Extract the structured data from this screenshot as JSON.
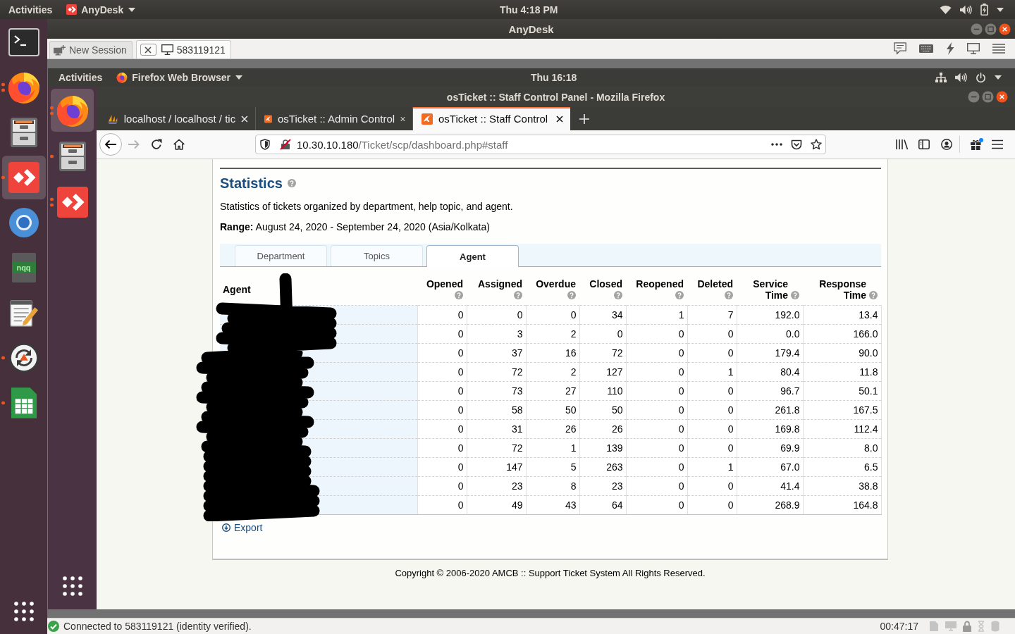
{
  "top_bar": {
    "activities": "Activities",
    "app_menu": "AnyDesk",
    "clock": "Thu 4:18 PM"
  },
  "dock": {
    "items": [
      {
        "kind": "terminal",
        "running": false,
        "multiple_windows": false,
        "selected": false
      },
      {
        "kind": "firefox",
        "running": true,
        "multiple_windows": true,
        "selected": false
      },
      {
        "kind": "files",
        "running": false,
        "multiple_windows": false,
        "selected": false
      },
      {
        "kind": "anydesk",
        "running": true,
        "multiple_windows": false,
        "selected": true
      },
      {
        "kind": "chromium",
        "running": false,
        "multiple_windows": false,
        "selected": false
      },
      {
        "kind": "notepadqq",
        "label": "nqq",
        "running": false,
        "multiple_windows": false,
        "selected": false
      },
      {
        "kind": "text_editor",
        "running": false,
        "multiple_windows": false,
        "selected": false
      },
      {
        "kind": "software_updater",
        "running": true,
        "multiple_windows": false,
        "selected": false
      },
      {
        "kind": "spreadsheet",
        "running": true,
        "multiple_windows": false,
        "selected": false
      }
    ]
  },
  "anydesk": {
    "title": "AnyDesk",
    "tabs": [
      {
        "kind": "new_session",
        "label": "New Session",
        "selected": false
      },
      {
        "kind": "session",
        "label": "583119121",
        "selected": true
      }
    ]
  },
  "remote_top_bar": {
    "activities": "Activities",
    "app_menu": "Firefox Web Browser",
    "clock": "Thu 16:18"
  },
  "remote_dock": {
    "items": [
      {
        "kind": "firefox",
        "running": true,
        "multiple_windows": true,
        "selected": true
      },
      {
        "kind": "files",
        "running": true,
        "multiple_windows": false,
        "selected": false
      },
      {
        "kind": "anydesk",
        "running": true,
        "multiple_windows": true,
        "selected": false
      }
    ]
  },
  "firefox": {
    "title": "osTicket :: Staff Control Panel - Mozilla Firefox",
    "tabs": [
      {
        "kind": "database",
        "label": "localhost / localhost / tic",
        "selected": false
      },
      {
        "kind": "ticket",
        "label": "osTicket :: Admin Control",
        "selected": false
      },
      {
        "kind": "ticket",
        "label": "osTicket :: Staff Control",
        "selected": true
      }
    ],
    "url": {
      "host": "10.30.10.180",
      "path": "/Ticket/scp/dashboard.php#staff"
    }
  },
  "page": {
    "title": "Statistics",
    "title_help": true,
    "description": "Statistics of tickets organized by department, help topic, and agent.",
    "range": "**Range:** August 24, 2020 - September 24, 2020 (Asia/Kolkata)",
    "tabs": [
      {
        "label": "Department",
        "selected": false
      },
      {
        "label": "Topics",
        "selected": false
      },
      {
        "label": "Agent",
        "selected": true
      }
    ],
    "table": {
      "agent_names_scribbled": true,
      "columns": [
        {
          "label": "Agent",
          "help": false
        },
        {
          "label": "Opened",
          "help": true
        },
        {
          "label": "Assigned",
          "help": true
        },
        {
          "label": "Overdue",
          "help": true
        },
        {
          "label": "Closed",
          "help": true
        },
        {
          "label": "Reopened",
          "help": true
        },
        {
          "label": "Deleted",
          "help": true
        },
        {
          "label": "Service Time",
          "help": true
        },
        {
          "label": "Response Time",
          "help": true
        }
      ],
      "rows": [
        {
          "values": [
            "0",
            "0",
            "0",
            "34",
            "1",
            "7",
            "192.0",
            "13.4"
          ]
        },
        {
          "values": [
            "0",
            "3",
            "2",
            "0",
            "0",
            "0",
            "0.0",
            "166.0"
          ]
        },
        {
          "values": [
            "0",
            "37",
            "16",
            "72",
            "0",
            "0",
            "179.4",
            "90.0"
          ]
        },
        {
          "values": [
            "0",
            "72",
            "2",
            "127",
            "0",
            "1",
            "80.4",
            "11.8"
          ]
        },
        {
          "values": [
            "0",
            "73",
            "27",
            "110",
            "0",
            "0",
            "96.7",
            "50.1"
          ]
        },
        {
          "values": [
            "0",
            "58",
            "50",
            "50",
            "0",
            "0",
            "261.8",
            "167.5"
          ]
        },
        {
          "values": [
            "0",
            "31",
            "26",
            "26",
            "0",
            "0",
            "169.8",
            "112.4"
          ]
        },
        {
          "values": [
            "0",
            "72",
            "1",
            "139",
            "0",
            "0",
            "69.9",
            "8.0"
          ]
        },
        {
          "values": [
            "0",
            "147",
            "5",
            "263",
            "0",
            "1",
            "67.0",
            "6.5"
          ]
        },
        {
          "values": [
            "0",
            "23",
            "8",
            "23",
            "0",
            "0",
            "41.4",
            "38.8"
          ]
        },
        {
          "values": [
            "0",
            "49",
            "43",
            "64",
            "0",
            "0",
            "268.9",
            "164.8"
          ]
        }
      ]
    },
    "export": "Export",
    "footer": "Copyright © 2006-2020 AMCB :: Support Ticket System All Rights Reserved."
  },
  "status_bar": {
    "message": "Connected to 583119121 (identity verified).",
    "timer": "00:47:17"
  }
}
